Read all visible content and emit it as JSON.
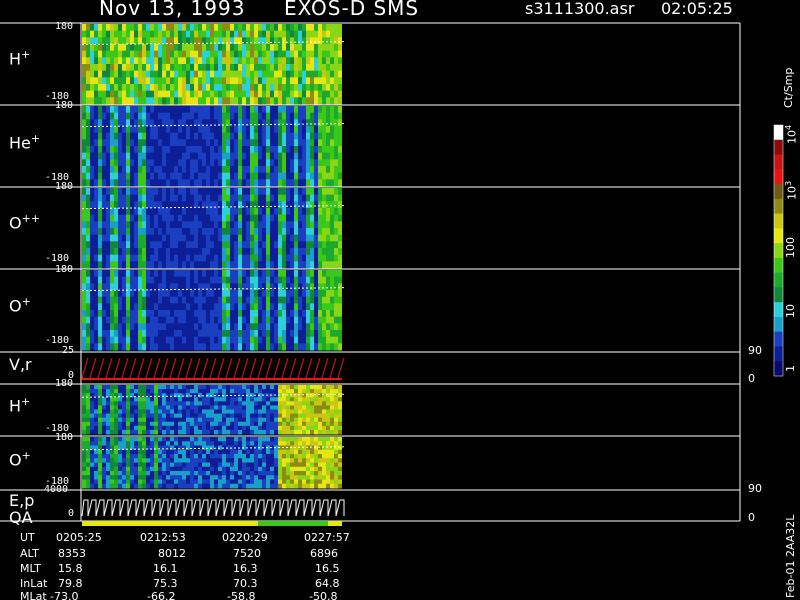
{
  "header": {
    "date_label": "Nov 13, 1993",
    "instrument_label": "EXOS-D SMS",
    "filename": "s3111300.asr",
    "time_label": "02:05:25"
  },
  "colorbar": {
    "unit_label": "Ct/Smp",
    "tick_labels": [
      "1",
      "10",
      "100",
      "10",
      "10"
    ],
    "tick_exponents": [
      "",
      "",
      "",
      "3",
      "4"
    ],
    "colors": [
      "#0a0a6e",
      "#0d1f96",
      "#1a3fc0",
      "#1aa0c8",
      "#2ed0d8",
      "#12863a",
      "#1da82e",
      "#3cc81a",
      "#8ad614",
      "#e6e614",
      "#c8c814",
      "#8c8c14",
      "#6e5a14",
      "#e61414",
      "#c81414",
      "#8c0a0a",
      "#ffffff"
    ]
  },
  "chart_data": {
    "type": "heatmap",
    "time_axis": {
      "tick_labels": [
        "0205:25",
        "0212:53",
        "0220:29",
        "0227:57"
      ],
      "ephemeris": [
        {
          "name": "UT",
          "values": [
            "0205:25",
            "0212:53",
            "0220:29",
            "0227:57"
          ]
        },
        {
          "name": "ALT",
          "values": [
            "8353",
            "8012",
            "7520",
            "6896"
          ]
        },
        {
          "name": "MLT",
          "values": [
            "15.8",
            "16.1",
            "16.3",
            "16.5"
          ]
        },
        {
          "name": "InLat",
          "values": [
            "79.8",
            "75.3",
            "70.3",
            "64.8"
          ]
        },
        {
          "name": "MLat",
          "values": [
            "-73.0",
            "-66.2",
            "-58.8",
            "-50.8"
          ]
        }
      ]
    },
    "panels": [
      {
        "label": "H",
        "charge": "+",
        "y_top": "180",
        "y_bottom": "-180",
        "type": "heatmap"
      },
      {
        "label": "He",
        "charge": "+",
        "y_top": "180",
        "y_bottom": "-180",
        "type": "heatmap"
      },
      {
        "label": "O",
        "charge": "++",
        "y_top": "180",
        "y_bottom": "-180",
        "type": "heatmap"
      },
      {
        "label": "O",
        "charge": "+",
        "y_top": "180",
        "y_bottom": "-180",
        "type": "heatmap"
      },
      {
        "label": "V,r",
        "y_top": "25",
        "y_bottom": "0",
        "right_top": "90",
        "right_bottom": "0",
        "type": "line"
      },
      {
        "label": "H",
        "charge": "+",
        "y_top": "180",
        "y_bottom": "-180",
        "type": "heatmap"
      },
      {
        "label": "O",
        "charge": "+",
        "y_top": "180",
        "y_bottom": "-180",
        "type": "heatmap"
      },
      {
        "label": "E,p",
        "label2": "QA",
        "y_top": "4000",
        "y_bottom": "0",
        "right_top": "90",
        "right_bottom": "0",
        "type": "line"
      }
    ]
  },
  "footer": {
    "version_label": "Feb-01 2AA32L"
  }
}
